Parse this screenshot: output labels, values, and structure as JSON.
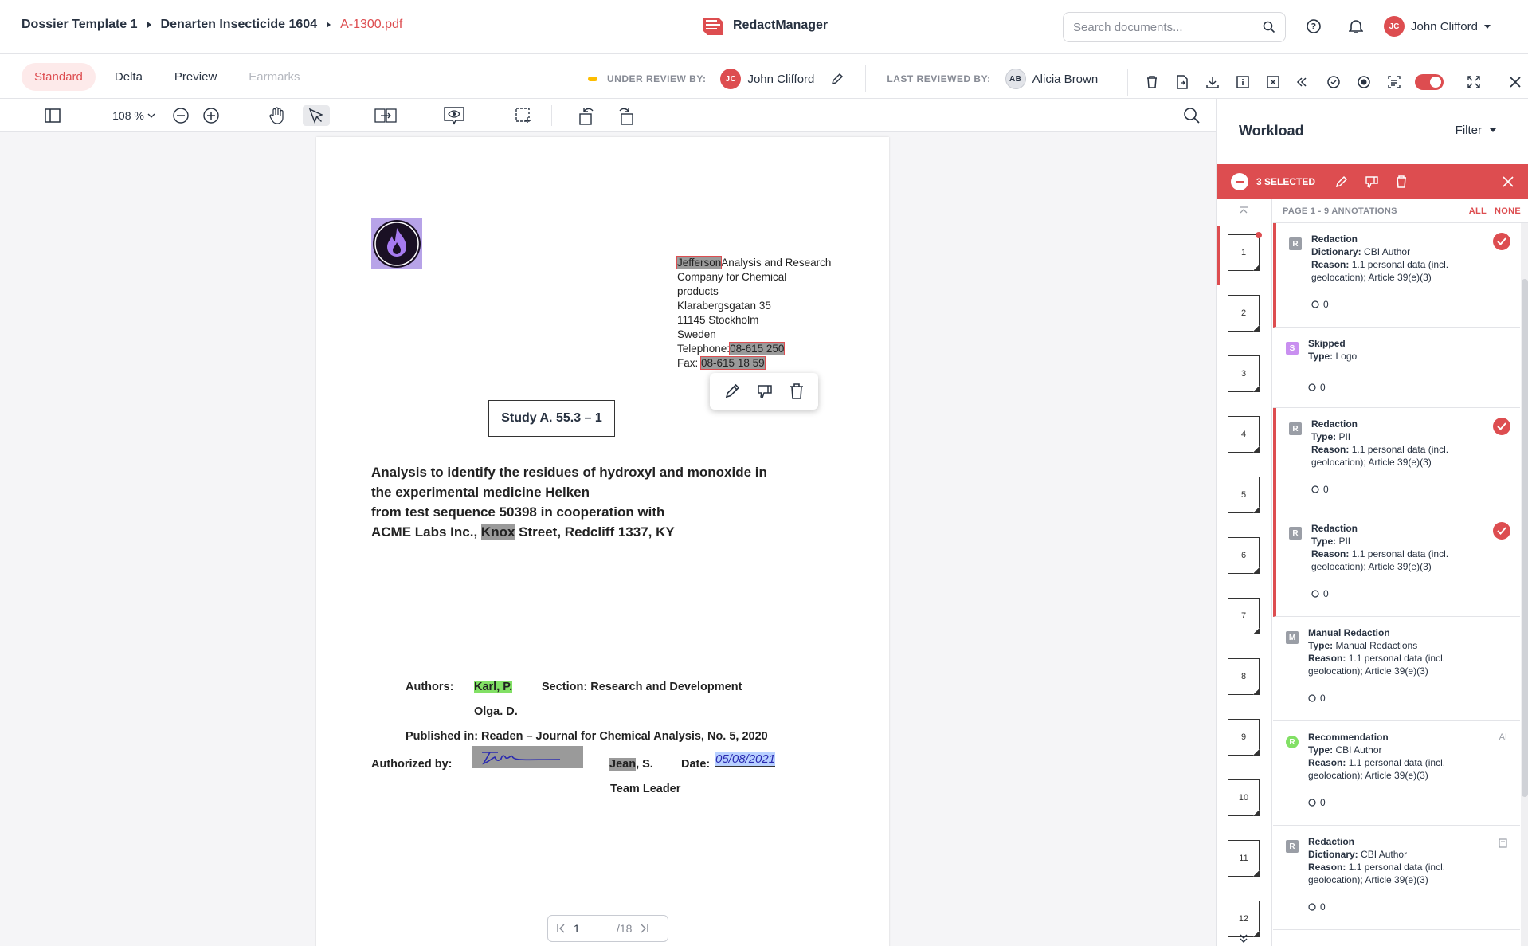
{
  "breadcrumb": {
    "items": [
      "Dossier Template 1",
      "Denarten Insecticide 1604"
    ],
    "current": "A-1300.pdf"
  },
  "app": {
    "name": "RedactManager"
  },
  "search": {
    "placeholder": "Search documents..."
  },
  "user": {
    "initials": "JC",
    "name": "John Clifford"
  },
  "tabs": [
    {
      "label": "Standard"
    },
    {
      "label": "Delta"
    },
    {
      "label": "Preview"
    },
    {
      "label": "Earmarks"
    }
  ],
  "review": {
    "under_label": "UNDER REVIEW BY:",
    "under_initials": "JC",
    "under_name": "John Clifford",
    "last_label": "LAST REVIEWED BY:",
    "last_initials": "AB",
    "last_name": "Alicia Brown"
  },
  "toolbar": {
    "zoom": "108 %"
  },
  "document": {
    "address": [
      "Jefferson",
      "Analysis and Research",
      "Company for Chemical",
      "products",
      "Klarabergsgatan 35",
      "11145 Stockholm",
      "Sweden",
      "Telephone:",
      "08-615 250",
      "Fax:",
      "08-615 18 59"
    ],
    "study": "Study A. 55.3 – 1",
    "title_lines": [
      "Analysis to identify the residues of hydroxyl and monoxide in",
      "the experimental medicine Helken",
      "from test sequence 50398 in cooperation with",
      "ACME Labs Inc.,",
      "Knox",
      "Street, Redcliff 1337, KY"
    ],
    "authors_label": "Authors:",
    "author1": "Karl, P.",
    "section": "Section: Research and Development",
    "author2": "Olga. D.",
    "published": "Published in: Readen – Journal for Chemical Analysis, No. 5, 2020",
    "authorized_label": "Authorized by:",
    "signer_first": "Jean",
    "signer_rest": ", S.",
    "date_label": "Date:",
    "date_value": "05/08/2021",
    "team_leader": "Team Leader"
  },
  "pager": {
    "current": "1",
    "total": "/18"
  },
  "panel": {
    "title": "Workload",
    "filter": "Filter",
    "selected": "3 SELECTED",
    "page_header": "PAGE 1 - 9 ANNOTATIONS",
    "all": "ALL",
    "none": "NONE",
    "thumbs": [
      "1",
      "2",
      "3",
      "4",
      "5",
      "6",
      "7",
      "8",
      "9",
      "10",
      "11",
      "12"
    ],
    "annotations": [
      {
        "badge": "R",
        "title": "Redaction",
        "l1": "Dictionary:",
        "v1": "CBI Author",
        "l2": "Reason:",
        "v2": "1.1 personal data (incl. geolocation); Article 39(e)(3)",
        "comments": "0"
      },
      {
        "badge": "S",
        "title": "Skipped",
        "l1": "Type:",
        "v1": "Logo",
        "comments": "0"
      },
      {
        "badge": "R",
        "title": "Redaction",
        "l1": "Type:",
        "v1": "PII",
        "l2": "Reason:",
        "v2": "1.1 personal data (incl. geolocation); Article 39(e)(3)",
        "comments": "0"
      },
      {
        "badge": "R",
        "title": "Redaction",
        "l1": "Type:",
        "v1": "PII",
        "l2": "Reason:",
        "v2": "1.1 personal data (incl. geolocation); Article 39(e)(3)",
        "comments": "0"
      },
      {
        "badge": "M",
        "title": "Manual Redaction",
        "l1": "Type:",
        "v1": "Manual Redactions",
        "l2": "Reason:",
        "v2": "1.1 personal data (incl. geolocation); Article 39(e)(3)",
        "comments": "0"
      },
      {
        "badge": "R",
        "title": "Recommendation",
        "l1": "Type:",
        "v1": "CBI Author",
        "l2": "Reason:",
        "v2": "1.1 personal data (incl. geolocation); Article 39(e)(3)",
        "comments": "0",
        "tag": "AI"
      },
      {
        "badge": "R",
        "title": "Redaction",
        "l1": "Dictionary:",
        "v1": "CBI Author",
        "l2": "Reason:",
        "v2": "1.1 personal data (incl. geolocation); Article 39(e)(3)",
        "comments": "0"
      }
    ]
  },
  "colors": {
    "accent": "#dd4d50",
    "highlight": "#9a9a9a",
    "green": "#82e065",
    "skipped": "#c98ff0",
    "recommend": "#82e065"
  }
}
